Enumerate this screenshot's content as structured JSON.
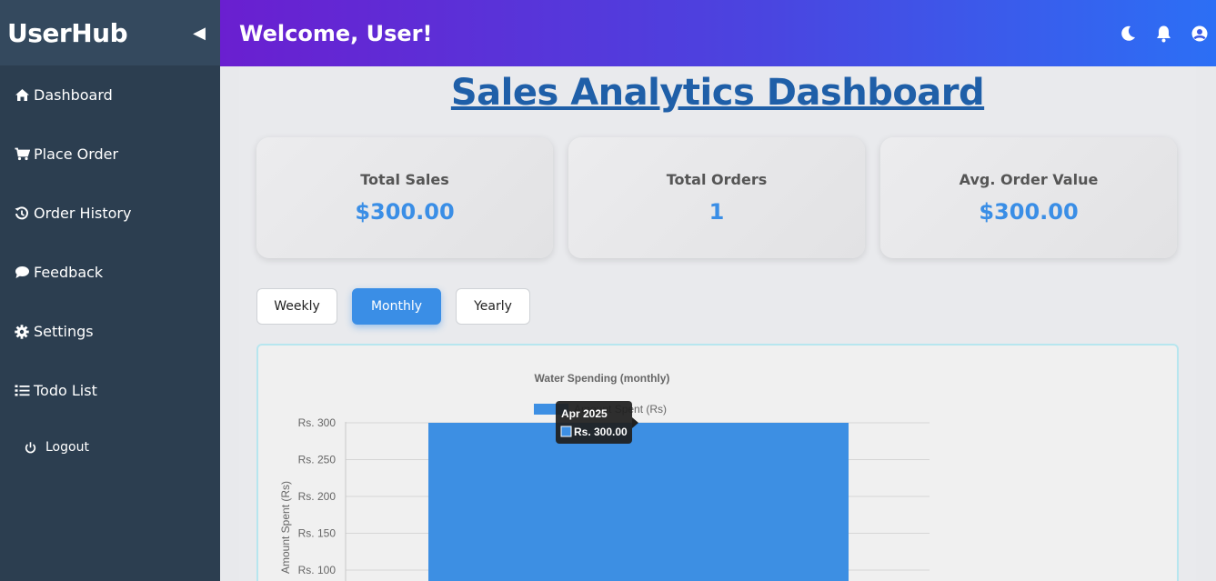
{
  "sidebar": {
    "brand": "UserHub",
    "collapse_icon": "◀",
    "items": [
      {
        "label": "Dashboard",
        "icon": "home-icon"
      },
      {
        "label": "Place Order",
        "icon": "cart-icon"
      },
      {
        "label": "Order History",
        "icon": "history-icon"
      },
      {
        "label": "Feedback",
        "icon": "comment-icon"
      },
      {
        "label": "Settings",
        "icon": "gear-icon"
      },
      {
        "label": "Todo List",
        "icon": "list-icon"
      }
    ],
    "logout": "Logout"
  },
  "header": {
    "welcome": "Welcome, User!"
  },
  "main": {
    "title": "Sales Analytics Dashboard",
    "stats": [
      {
        "label": "Total Sales",
        "value": "$300.00"
      },
      {
        "label": "Total Orders",
        "value": "1"
      },
      {
        "label": "Avg. Order Value",
        "value": "$300.00"
      }
    ],
    "periods": [
      "Weekly",
      "Monthly",
      "Yearly"
    ],
    "active_period": "Monthly"
  },
  "chart_data": {
    "type": "bar",
    "title": "Water Spending (monthly)",
    "legend": "Amount Spent (Rs)",
    "legend_position": "top",
    "ylabel": "Amount Spent (Rs)",
    "categories": [
      "Apr 2025"
    ],
    "series": [
      {
        "name": "Amount Spent (Rs)",
        "values": [
          300
        ]
      }
    ],
    "yticks": [
      "Rs. 300",
      "Rs. 250",
      "Rs. 200",
      "Rs. 150",
      "Rs. 100"
    ],
    "ytick_values": [
      300,
      250,
      200,
      150,
      100
    ],
    "ylim": [
      0,
      300
    ],
    "grid": true,
    "color": "#3d8fe3",
    "tooltip": {
      "title": "Apr 2025",
      "value": "Rs. 300.00"
    }
  }
}
